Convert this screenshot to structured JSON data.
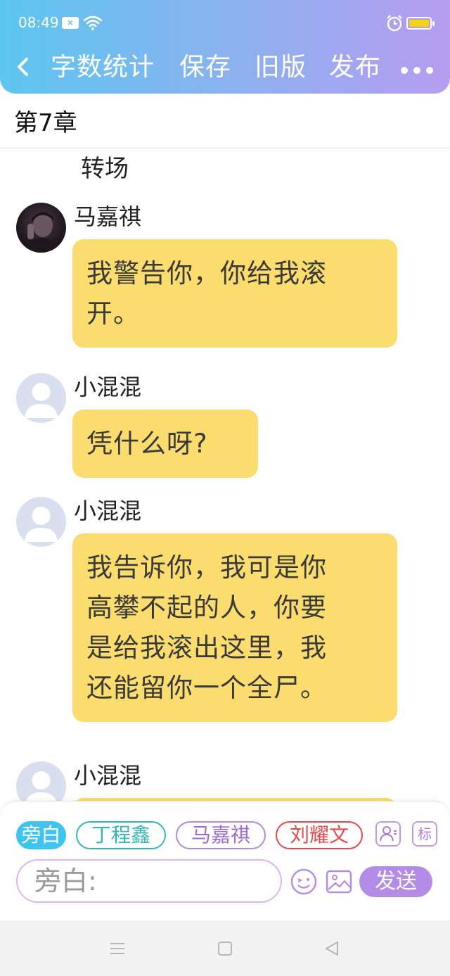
{
  "status_bar": {
    "time": "08:49"
  },
  "nav": {
    "word_count": "字数统计",
    "save": "保存",
    "old_version": "旧版",
    "publish": "发布"
  },
  "chapter": {
    "title": "第7章"
  },
  "scene_text": "转场",
  "messages": [
    {
      "name": "马嘉祺",
      "text_lines": [
        "我警告你，你给我滚",
        "开。"
      ]
    },
    {
      "name": "小混混",
      "text_lines": [
        "凭什么呀?"
      ]
    },
    {
      "name": "小混混",
      "text_lines": [
        "我告诉你，我可是你",
        "高攀不起的人，你要",
        "是给我滚出这里，我",
        "还能留你一个全尸。"
      ]
    },
    {
      "name": "小混混",
      "text_lines": []
    }
  ],
  "composer": {
    "roles": [
      "旁白",
      "丁程鑫",
      "马嘉祺",
      "刘耀文"
    ],
    "tag_label": "标",
    "input_placeholder": "旁白:",
    "send_label": "发送"
  },
  "colors": {
    "header_start": "#5cc6f0",
    "header_end": "#b79cf0",
    "bubble": "#fbdc6e",
    "send": "#b48be6"
  }
}
